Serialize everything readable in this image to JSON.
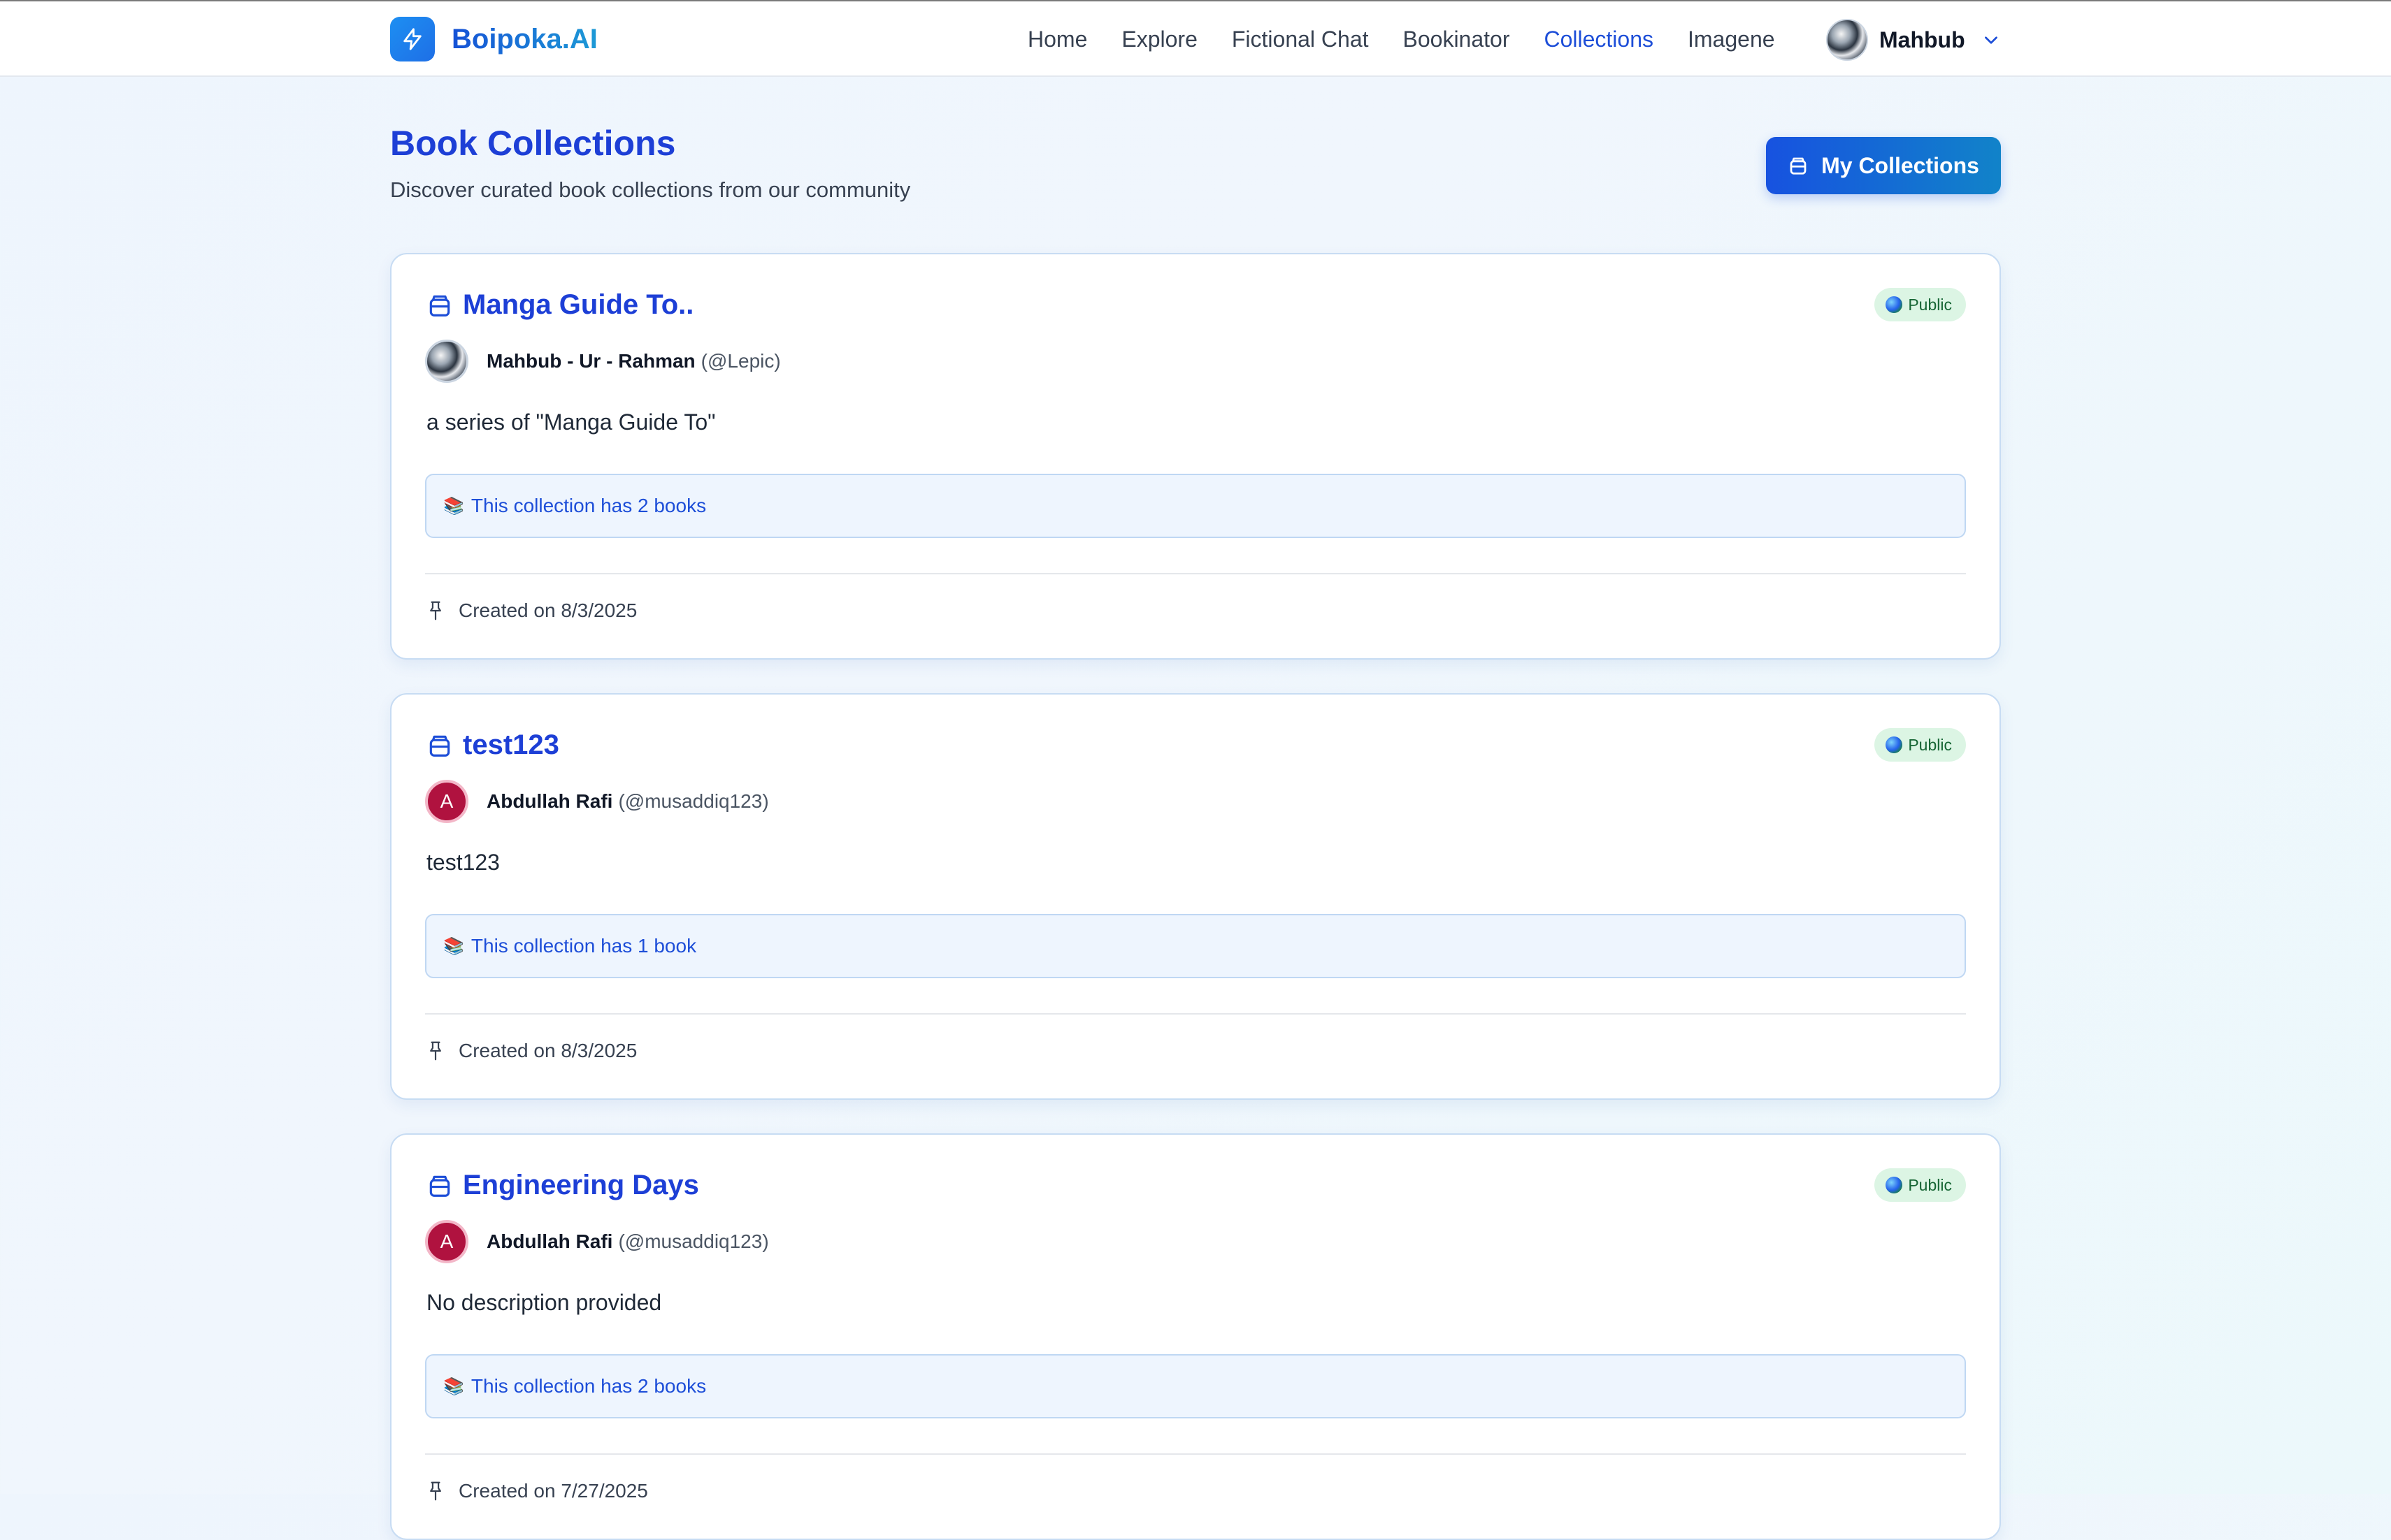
{
  "brand": {
    "name": "Boipoka.AI"
  },
  "nav": {
    "items": [
      {
        "label": "Home",
        "active": false
      },
      {
        "label": "Explore",
        "active": false
      },
      {
        "label": "Fictional Chat",
        "active": false
      },
      {
        "label": "Bookinator",
        "active": false
      },
      {
        "label": "Collections",
        "active": true
      },
      {
        "label": "Imagene",
        "active": false
      }
    ],
    "user_name": "Mahbub"
  },
  "page": {
    "title": "Book Collections",
    "subtitle": "Discover curated book collections from our community",
    "my_collections_label": "My Collections"
  },
  "collections": [
    {
      "title": "Manga Guide To..",
      "visibility": "Public",
      "author_name": "Mahbub - Ur - Rahman",
      "author_handle": "(@Lepic)",
      "avatar_type": "photo",
      "avatar_letter": "",
      "description": "a series of \"Manga Guide To\"",
      "book_count_text": "This collection has 2 books",
      "created": "Created on 8/3/2025"
    },
    {
      "title": "test123",
      "visibility": "Public",
      "author_name": "Abdullah Rafi",
      "author_handle": "(@musaddiq123)",
      "avatar_type": "letter",
      "avatar_letter": "A",
      "description": "test123",
      "book_count_text": "This collection has 1 book",
      "created": "Created on 8/3/2025"
    },
    {
      "title": "Engineering Days",
      "visibility": "Public",
      "author_name": "Abdullah Rafi",
      "author_handle": "(@musaddiq123)",
      "avatar_type": "letter",
      "avatar_letter": "A",
      "description": "No description provided",
      "book_count_text": "This collection has 2 books",
      "created": "Created on 7/27/2025"
    }
  ],
  "icons": {
    "brand": "lightning-icon",
    "collection": "archive-icon",
    "visibility": "globe-icon",
    "books": "books-emoji",
    "created": "pin-icon",
    "dropdown": "chevron-down-icon"
  },
  "colors": {
    "accent": "#1d3fd6",
    "link": "#1d4ed8",
    "public_badge_bg": "#dcf5e4",
    "avatar_letter_bg": "#b0123f"
  }
}
